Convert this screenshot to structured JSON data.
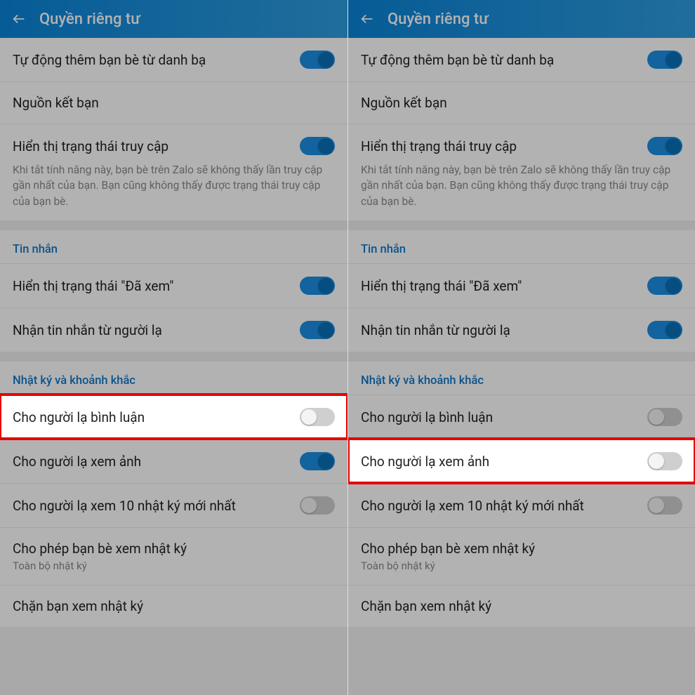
{
  "header": {
    "title": "Quyền riêng tư"
  },
  "common": {
    "auto_add": "Tự động thêm bạn bè từ danh bạ",
    "friend_source": "Nguồn kết bạn",
    "show_access": "Hiển thị trạng thái truy cập",
    "access_desc": "Khi tắt tính năng này, bạn bè trên Zalo sẽ không thấy lần truy cập gần nhất của bạn. Bạn cũng không thấy được trạng thái truy cập của bạn bè.",
    "sec_msg": "Tin nhắn",
    "seen_status": "Hiển thị trạng thái \"Đã xem\"",
    "stranger_msg": "Nhận tin nhắn từ người lạ",
    "sec_diary": "Nhật ký và khoảnh khắc",
    "stranger_comment": "Cho người lạ bình luận",
    "stranger_photo": "Cho người lạ xem ảnh",
    "stranger_10": "Cho người lạ xem 10 nhật ký mới nhất",
    "friends_diary": "Cho phép bạn bè xem nhật ký",
    "friends_diary_sub": "Toàn bộ nhật ký",
    "block_diary": "Chặn bạn xem nhật ký"
  },
  "left": {
    "toggles": {
      "auto_add": true,
      "show_access": true,
      "seen_status": true,
      "stranger_msg": true,
      "stranger_comment": false,
      "stranger_photo": true,
      "stranger_10": false
    },
    "highlight": "stranger_comment"
  },
  "right": {
    "toggles": {
      "auto_add": true,
      "show_access": true,
      "seen_status": true,
      "stranger_msg": true,
      "stranger_comment": false,
      "stranger_photo": false,
      "stranger_10": false
    },
    "highlight": "stranger_photo"
  }
}
